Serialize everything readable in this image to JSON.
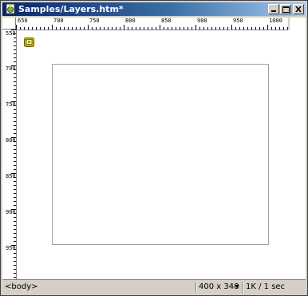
{
  "window": {
    "title": "Samples/Layers.htm*",
    "controls": [
      "minimize-icon",
      "maximize-icon",
      "close-icon"
    ]
  },
  "ruler": {
    "horizontal_labels": [
      "650",
      "700",
      "750",
      "800",
      "850",
      "900",
      "950",
      "1000"
    ],
    "vertical_labels": [
      "550",
      "700",
      "750",
      "800",
      "850",
      "900",
      "950"
    ]
  },
  "icons": {
    "layer_anchor": "layer-anchor-icon",
    "app": "dreamweaver-doc-icon"
  },
  "statusbar": {
    "tag_selector": "<body>",
    "window_size": "400 x 348",
    "download_stats": "1K / 1 sec"
  }
}
